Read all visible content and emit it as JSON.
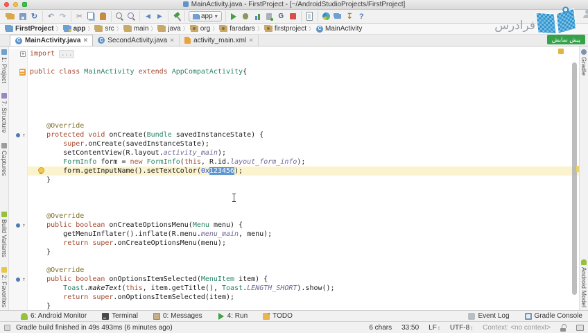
{
  "window": {
    "title": "MainActivity.java - FirstProject - [~/AndroidStudioProjects/FirstProject]"
  },
  "toolbar": {
    "run_config_label": "app",
    "groups": [
      [
        "open-icon",
        "save-icon",
        "sync-icon"
      ],
      [
        "undo-icon",
        "redo-icon"
      ],
      [
        "cut-icon",
        "copy-icon",
        "paste-icon"
      ],
      [
        "find-icon",
        "replace-icon"
      ],
      [
        "nav-back-icon",
        "nav-forward-icon"
      ],
      [
        "build-hammer-icon"
      ],
      [
        "run-config-select"
      ],
      [
        "run-icon",
        "debug-icon",
        "profiler-icon",
        "attach-debugger-icon",
        "coverage-icon",
        "stop-icon"
      ],
      [
        "avd-manager-icon"
      ],
      [
        "sdk-manager-icon",
        "project-structure-icon",
        "sdk-updates-icon",
        "help-icon"
      ]
    ]
  },
  "breadcrumbs": [
    {
      "label": "FirstProject",
      "icon": "project-folder-icon",
      "bold": true
    },
    {
      "label": "app",
      "icon": "module-folder-icon",
      "bold": true
    },
    {
      "label": "src",
      "icon": "folder-icon",
      "bold": false
    },
    {
      "label": "main",
      "icon": "folder-icon",
      "bold": false
    },
    {
      "label": "java",
      "icon": "folder-icon",
      "bold": false
    },
    {
      "label": "org",
      "icon": "package-icon",
      "bold": false
    },
    {
      "label": "faradars",
      "icon": "package-icon",
      "bold": false
    },
    {
      "label": "firstproject",
      "icon": "package-icon",
      "bold": false
    },
    {
      "label": "MainActivity",
      "icon": "class-icon",
      "bold": false
    }
  ],
  "tabs": [
    {
      "label": "MainActivity.java",
      "icon": "java-class-icon",
      "active": true
    },
    {
      "label": "SecondActivity.java",
      "icon": "java-class-icon",
      "active": false
    },
    {
      "label": "activity_main.xml",
      "icon": "xml-file-icon",
      "active": false
    }
  ],
  "left_stripe": {
    "top": [
      {
        "label": "1: Project",
        "icon": "project-icon"
      },
      {
        "label": "7: Structure",
        "icon": "structure-icon"
      },
      {
        "label": "Captures",
        "icon": "captures-icon"
      }
    ],
    "bottom": [
      {
        "label": "Build Variants",
        "icon": "build-variants-icon"
      },
      {
        "label": "2: Favorites",
        "icon": "favorites-icon"
      }
    ]
  },
  "right_stripe": {
    "top": [
      {
        "label": "Gradle",
        "icon": "gradle-icon"
      }
    ],
    "bottom": [
      {
        "label": "Android Model",
        "icon": "android-icon"
      }
    ]
  },
  "editor": {
    "syntax_colors": {
      "keyword": "#A5492F",
      "type": "#2B8464",
      "annotation": "#7F6E27",
      "field_italic": "#716898",
      "number": "#1750EB",
      "selection_bg": "#5E95D0",
      "line_highlight": "#FBF2CE"
    },
    "lines": [
      {
        "gutter": "fold-plus",
        "seg": [
          [
            "k",
            "import "
          ],
          [
            "g",
            "..."
          ]
        ]
      },
      {
        "seg": []
      },
      {
        "gutter": "related",
        "seg": [
          [
            "k",
            "public class "
          ],
          [
            "t",
            "MainActivity"
          ],
          [
            "d",
            " "
          ],
          [
            "k",
            "extends"
          ],
          [
            "d",
            " "
          ],
          [
            "t",
            "AppCompatActivity"
          ],
          [
            "d",
            "{"
          ]
        ]
      },
      {
        "seg": []
      },
      {
        "seg": []
      },
      {
        "seg": []
      },
      {
        "seg": []
      },
      {
        "seg": []
      },
      {
        "seg": [
          [
            "d",
            "    "
          ],
          [
            "a",
            "@Override"
          ]
        ]
      },
      {
        "gutter": "override",
        "seg": [
          [
            "d",
            "    "
          ],
          [
            "k",
            "protected void "
          ],
          [
            "d",
            "onCreate("
          ],
          [
            "t",
            "Bundle"
          ],
          [
            "d",
            " savedInstanceState) {"
          ]
        ]
      },
      {
        "seg": [
          [
            "d",
            "        "
          ],
          [
            "k",
            "super"
          ],
          [
            "d",
            ".onCreate(savedInstanceState);"
          ]
        ]
      },
      {
        "seg": [
          [
            "d",
            "        setContentView(R.layout."
          ],
          [
            "f",
            "activity_main"
          ],
          [
            "d",
            ");"
          ]
        ]
      },
      {
        "seg": [
          [
            "d",
            "        "
          ],
          [
            "t",
            "FormInfo"
          ],
          [
            "d",
            " form = "
          ],
          [
            "k",
            "new"
          ],
          [
            "d",
            " "
          ],
          [
            "t",
            "FormInfo"
          ],
          [
            "d",
            "("
          ],
          [
            "k",
            "this"
          ],
          [
            "d",
            ", R.id."
          ],
          [
            "f",
            "layout_form_info"
          ],
          [
            "d",
            ");"
          ]
        ]
      },
      {
        "hl": true,
        "gutter": "bulb",
        "seg": [
          [
            "d",
            "        form.getInputName().setTextColor("
          ],
          [
            "n",
            "0x"
          ],
          [
            "sel",
            "123456"
          ],
          [
            "d",
            ");"
          ]
        ]
      },
      {
        "seg": [
          [
            "d",
            "    }"
          ]
        ]
      },
      {
        "seg": []
      },
      {
        "seg": []
      },
      {
        "seg": []
      },
      {
        "seg": [
          [
            "d",
            "    "
          ],
          [
            "a",
            "@Override"
          ]
        ]
      },
      {
        "gutter": "override",
        "seg": [
          [
            "d",
            "    "
          ],
          [
            "k",
            "public boolean "
          ],
          [
            "d",
            "onCreateOptionsMenu("
          ],
          [
            "t",
            "Menu"
          ],
          [
            "d",
            " menu) {"
          ]
        ]
      },
      {
        "seg": [
          [
            "d",
            "        getMenuInflater().inflate(R.menu."
          ],
          [
            "f",
            "menu_main"
          ],
          [
            "d",
            ", menu);"
          ]
        ]
      },
      {
        "seg": [
          [
            "d",
            "        "
          ],
          [
            "k",
            "return super"
          ],
          [
            "d",
            ".onCreateOptionsMenu(menu);"
          ]
        ]
      },
      {
        "seg": [
          [
            "d",
            "    }"
          ]
        ]
      },
      {
        "seg": []
      },
      {
        "seg": [
          [
            "d",
            "    "
          ],
          [
            "a",
            "@Override"
          ]
        ]
      },
      {
        "gutter": "override",
        "seg": [
          [
            "d",
            "    "
          ],
          [
            "k",
            "public boolean "
          ],
          [
            "d",
            "onOptionsItemSelected("
          ],
          [
            "t",
            "MenuItem"
          ],
          [
            "d",
            " item) {"
          ]
        ]
      },
      {
        "seg": [
          [
            "d",
            "        "
          ],
          [
            "t",
            "Toast"
          ],
          [
            "d",
            "."
          ],
          [
            "i",
            "makeText"
          ],
          [
            "d",
            "("
          ],
          [
            "k",
            "this"
          ],
          [
            "d",
            ", item.getTitle(), "
          ],
          [
            "t",
            "Toast"
          ],
          [
            "d",
            "."
          ],
          [
            "f",
            "LENGTH_SHORT"
          ],
          [
            "d",
            ").show();"
          ]
        ]
      },
      {
        "seg": [
          [
            "d",
            "        "
          ],
          [
            "k",
            "return super"
          ],
          [
            "d",
            ".onOptionsItemSelected(item);"
          ]
        ]
      },
      {
        "seg": [
          [
            "d",
            "    }"
          ]
        ]
      }
    ]
  },
  "bottom_bar": {
    "left": [
      {
        "label": "6: Android Monitor",
        "icon": "android-monitor-icon"
      },
      {
        "label": "Terminal",
        "icon": "terminal-icon"
      },
      {
        "label": "0: Messages",
        "icon": "messages-icon"
      },
      {
        "label": "4: Run",
        "icon": "run-tool-icon"
      },
      {
        "label": "TODO",
        "icon": "todo-icon"
      }
    ],
    "right": [
      {
        "label": "Event Log",
        "icon": "event-log-icon"
      },
      {
        "label": "Gradle Console",
        "icon": "gradle-console-icon"
      }
    ]
  },
  "status_bar": {
    "message": "Gradle build finished in 49s 493ms (6 minutes ago)",
    "selection_info": "6 chars",
    "caret_position": "33:50",
    "line_ending": "LF",
    "encoding": "UTF-8",
    "context": "Context: <no context>"
  },
  "watermark": {
    "brand_text": "فرادرس",
    "badge_text": "پیش نمایش",
    "brand_blue": "#2E8FC9",
    "badge_green": "#35A24A"
  }
}
